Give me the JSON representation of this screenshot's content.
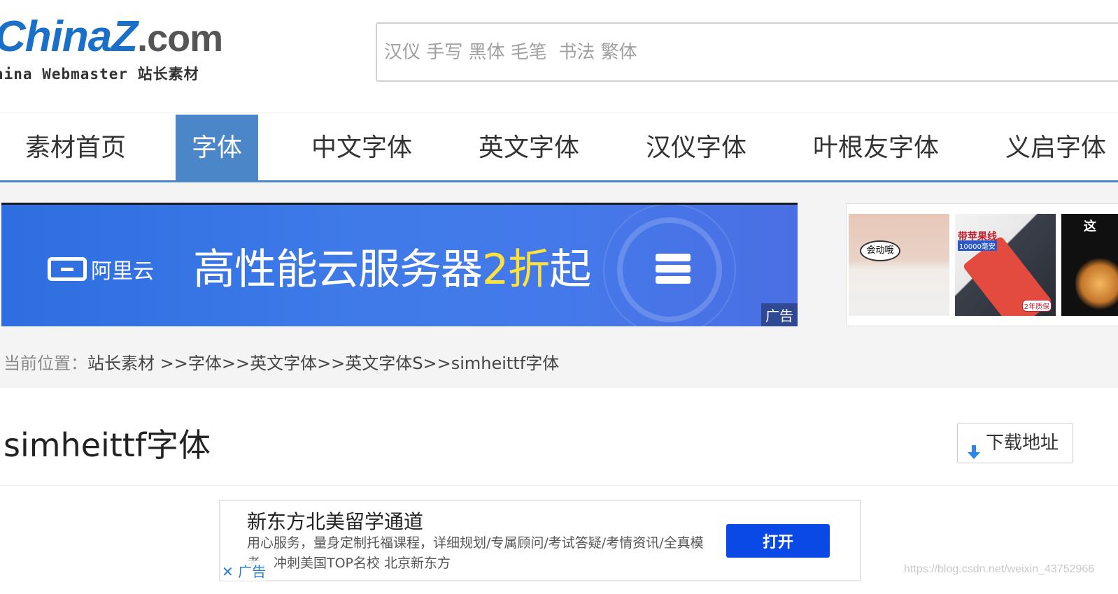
{
  "header": {
    "logo_main": "China",
    "logo_z": "Z",
    "logo_dotcom": ".com",
    "logo_sub": "hina Webmaster 站长素材",
    "search_placeholder": "汉仪 手写 黑体 毛笔  书法 繁体"
  },
  "nav": {
    "items": [
      {
        "label": "素材首页",
        "active": false
      },
      {
        "label": "字体",
        "active": true
      },
      {
        "label": "中文字体",
        "active": false
      },
      {
        "label": "英文字体",
        "active": false
      },
      {
        "label": "汉仪字体",
        "active": false
      },
      {
        "label": "叶根友字体",
        "active": false
      },
      {
        "label": "义启字体",
        "active": false
      }
    ]
  },
  "banner_ad": {
    "brand": "阿里云",
    "headline_pre": "高性能云服务器",
    "headline_highlight": "2折",
    "headline_post": "起",
    "ad_tag": "广告"
  },
  "thumb_ads": {
    "thumb1_text": "会动哦",
    "thumb2_label1": "带苹果线",
    "thumb2_label2": "10000毫安",
    "thumb2_label3": "2年质保",
    "thumb3_text": "这"
  },
  "breadcrumb": {
    "label": "当前位置：",
    "path": "站长素材 >>字体>>英文字体>>英文字体S>>simheittf字体"
  },
  "page": {
    "title": "simheittf字体",
    "download_label": "下载地址"
  },
  "text_ad": {
    "title": "新东方北美留学通道",
    "description": "用心服务，量身定制托福课程，详细规划/专属顾问/考试答疑/考情资讯/全真模考，冲刺美国TOP名校 北京新东方",
    "button": "打开",
    "close_label": "广告"
  },
  "watermark": "https://blog.csdn.net/weixin_43752966",
  "colors": {
    "accent": "#4a86c8",
    "ad_button": "#0b49e6",
    "banner_bg": "#3f7ae8"
  }
}
